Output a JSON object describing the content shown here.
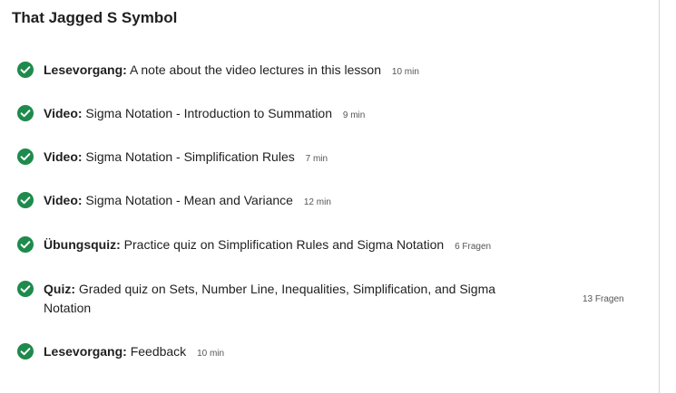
{
  "module": {
    "title": "That Jagged S Symbol"
  },
  "items": [
    {
      "type": "Lesevorgang:",
      "title": "A note about the video lectures in this lesson",
      "duration": "10 min"
    },
    {
      "type": "Video:",
      "title": "Sigma Notation - Introduction to Summation",
      "duration": "9 min"
    },
    {
      "type": "Video:",
      "title": "Sigma Notation - Simplification Rules",
      "duration": "7 min"
    },
    {
      "type": "Video:",
      "title": "Sigma Notation - Mean and Variance",
      "duration": "12 min"
    },
    {
      "type": "Übungsquiz:",
      "title": "Practice quiz on Simplification Rules and Sigma Notation",
      "duration": "6 Fragen"
    },
    {
      "type": "Quiz:",
      "title": "Graded quiz on Sets, Number Line, Inequalities, Simplification, and Sigma Notation",
      "duration": "13 Fragen"
    },
    {
      "type": "Lesevorgang:",
      "title": "Feedback",
      "duration": "10 min"
    }
  ],
  "colors": {
    "check": "#1e8a4c",
    "text": "#1f1f1f",
    "meta": "#555555"
  },
  "icons": {
    "completed": "check-circle-icon"
  }
}
